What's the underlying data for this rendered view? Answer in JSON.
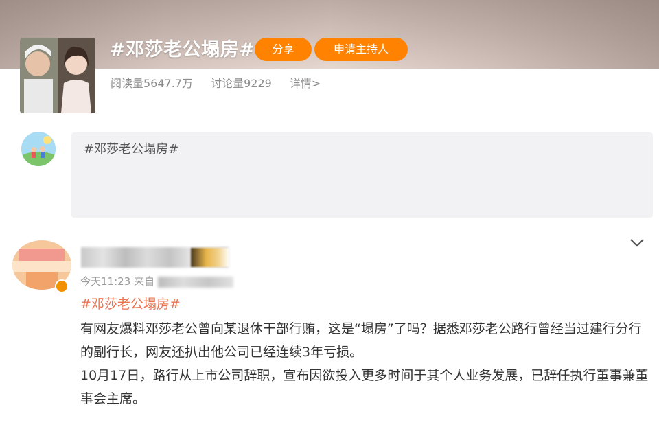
{
  "topic": {
    "title": "#邓莎老公塌房#",
    "share_label": "分享",
    "apply_host_label": "申请主持人",
    "stats": {
      "reads": "阅读量5647.7万",
      "discussions": "讨论量9229",
      "details_link": "详情>"
    }
  },
  "composer": {
    "value": "#邓莎老公塌房#"
  },
  "post": {
    "time": "今天11:23",
    "source_prefix": "来自",
    "hashtag": "#邓莎老公塌房#",
    "paragraphs": [
      "有网友爆料邓莎老公曾向某退休干部行贿，这是“塌房”了吗？据悉邓莎老公路行曾经当过建行分行的副行长，网友还扒出他公司已经连续3年亏损。",
      "10月17日，路行从上市公司辞职，宣布因欲投入更多时间于其个人业务发展，已辞任执行董事兼董事会主席。"
    ]
  },
  "colors": {
    "accent_orange": "#ff8200",
    "hashtag_color": "#eb7350",
    "verified_badge": "#f29100",
    "composer_bg": "#f2f2f5"
  },
  "icons": {
    "expand": "chevron-down-icon",
    "verified": "verified-badge-icon"
  }
}
